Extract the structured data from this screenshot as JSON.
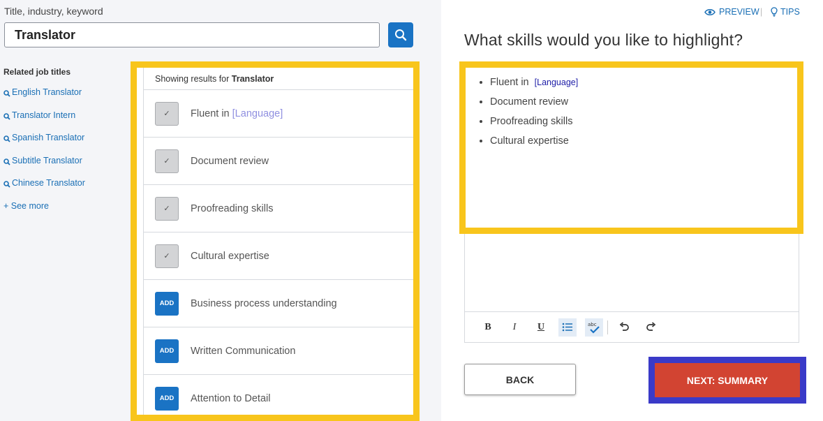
{
  "search": {
    "label": "Title, industry, keyword",
    "value": "Translator"
  },
  "related": {
    "title": "Related job titles",
    "items": [
      "English Translator",
      "Translator Intern",
      "Spanish Translator",
      "Subtitle Translator",
      "Chinese Translator"
    ],
    "see_more": "+ See more"
  },
  "results": {
    "showing_prefix": "Showing results for",
    "showing_term": "Translator",
    "rows": [
      {
        "label": "Fluent in",
        "placeholder": "[Language]",
        "state": "added"
      },
      {
        "label": "Document review",
        "placeholder": "",
        "state": "added"
      },
      {
        "label": "Proofreading skills",
        "placeholder": "",
        "state": "added"
      },
      {
        "label": "Cultural expertise",
        "placeholder": "",
        "state": "added"
      },
      {
        "label": "Business process understanding",
        "placeholder": "",
        "state": "add"
      },
      {
        "label": "Written Communication",
        "placeholder": "",
        "state": "add"
      },
      {
        "label": "Attention to Detail",
        "placeholder": "",
        "state": "add"
      }
    ],
    "add_label": "ADD",
    "check_glyph": "✓"
  },
  "header_links": {
    "preview": "PREVIEW",
    "tips": "TIPS",
    "separator": "|"
  },
  "question": "What skills would you like to highlight?",
  "editor": {
    "skills": [
      {
        "text": "Fluent in",
        "placeholder": "[Language]"
      },
      {
        "text": "Document review",
        "placeholder": ""
      },
      {
        "text": "Proofreading skills",
        "placeholder": ""
      },
      {
        "text": "Cultural expertise",
        "placeholder": ""
      }
    ],
    "toolbar": {
      "bold": "B",
      "italic": "I",
      "underline": "U"
    }
  },
  "buttons": {
    "back": "BACK",
    "next": "NEXT: SUMMARY"
  },
  "colors": {
    "accent_blue": "#1a73c4",
    "highlight_yellow": "#f8c51c",
    "highlight_purple": "#3a3ac8",
    "next_red": "#d24432"
  }
}
